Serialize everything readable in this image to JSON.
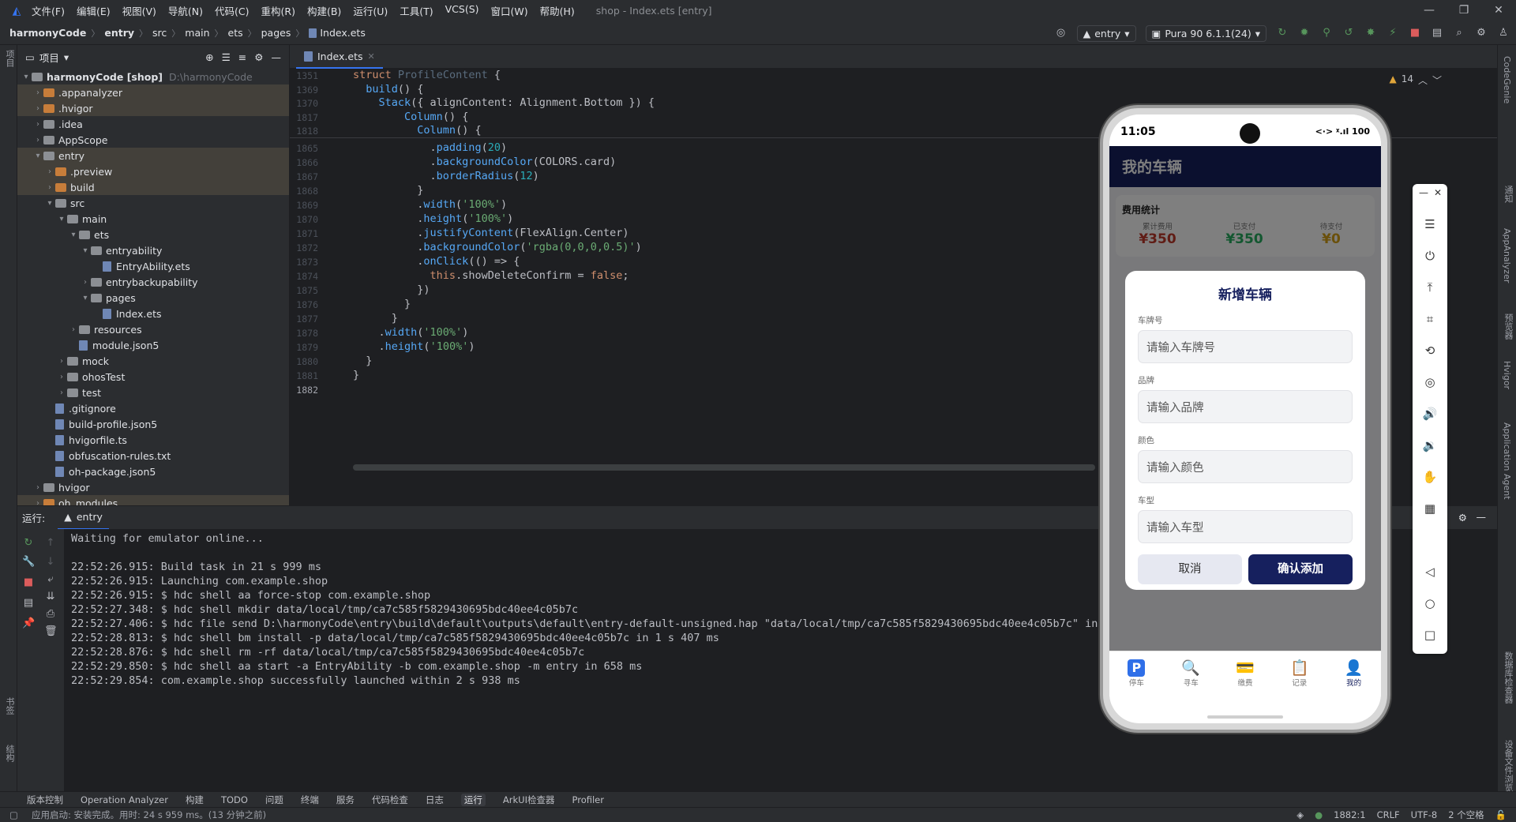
{
  "menu": {
    "items": [
      "文件(F)",
      "编辑(E)",
      "视图(V)",
      "导航(N)",
      "代码(C)",
      "重构(R)",
      "构建(B)",
      "运行(U)",
      "工具(T)",
      "VCS(S)",
      "窗口(W)",
      "帮助(H)"
    ],
    "window_title": "shop - Index.ets [entry]"
  },
  "breadcrumb": [
    "harmonyCode",
    "entry",
    "src",
    "main",
    "ets",
    "pages",
    "Index.ets"
  ],
  "toolbar": {
    "module": "entry",
    "device": "Pura 90 6.1.1(24)"
  },
  "project": {
    "header": "项目",
    "rows": [
      {
        "name": "harmonyCode [shop]",
        "hint": "D:\\harmonyCode",
        "level": 0,
        "type": "folder",
        "open": true,
        "hl": false
      },
      {
        "name": ".appanalyzer",
        "level": 1,
        "type": "folder-orange",
        "open": false,
        "hl": true
      },
      {
        "name": ".hvigor",
        "level": 1,
        "type": "folder-orange",
        "open": false,
        "hl": true
      },
      {
        "name": ".idea",
        "level": 1,
        "type": "folder",
        "open": false,
        "hl": false
      },
      {
        "name": "AppScope",
        "level": 1,
        "type": "folder",
        "open": false,
        "hl": false
      },
      {
        "name": "entry",
        "level": 1,
        "type": "folder",
        "open": true,
        "hl": true
      },
      {
        "name": ".preview",
        "level": 2,
        "type": "folder-orange",
        "open": false,
        "hl": true
      },
      {
        "name": "build",
        "level": 2,
        "type": "folder-orange",
        "open": false,
        "hl": true
      },
      {
        "name": "src",
        "level": 2,
        "type": "folder",
        "open": true,
        "hl": false
      },
      {
        "name": "main",
        "level": 3,
        "type": "folder",
        "open": true,
        "hl": false
      },
      {
        "name": "ets",
        "level": 4,
        "type": "folder",
        "open": true,
        "hl": false
      },
      {
        "name": "entryability",
        "level": 5,
        "type": "folder",
        "open": true,
        "hl": false
      },
      {
        "name": "EntryAbility.ets",
        "level": 6,
        "type": "file",
        "hl": false
      },
      {
        "name": "entrybackupability",
        "level": 5,
        "type": "folder",
        "open": false,
        "hl": false
      },
      {
        "name": "pages",
        "level": 5,
        "type": "folder",
        "open": true,
        "hl": false
      },
      {
        "name": "Index.ets",
        "level": 6,
        "type": "file",
        "hl": false
      },
      {
        "name": "resources",
        "level": 4,
        "type": "folder",
        "open": false,
        "hl": false
      },
      {
        "name": "module.json5",
        "level": 4,
        "type": "file",
        "hl": false
      },
      {
        "name": "mock",
        "level": 3,
        "type": "folder",
        "open": false,
        "hl": false
      },
      {
        "name": "ohosTest",
        "level": 3,
        "type": "folder",
        "open": false,
        "hl": false
      },
      {
        "name": "test",
        "level": 3,
        "type": "folder",
        "open": false,
        "hl": false
      },
      {
        "name": ".gitignore",
        "level": 2,
        "type": "file",
        "hl": false
      },
      {
        "name": "build-profile.json5",
        "level": 2,
        "type": "file",
        "hl": false
      },
      {
        "name": "hvigorfile.ts",
        "level": 2,
        "type": "file",
        "hl": false
      },
      {
        "name": "obfuscation-rules.txt",
        "level": 2,
        "type": "file",
        "hl": false
      },
      {
        "name": "oh-package.json5",
        "level": 2,
        "type": "file",
        "hl": false
      },
      {
        "name": "hvigor",
        "level": 1,
        "type": "folder",
        "open": false,
        "hl": false
      },
      {
        "name": "oh_modules",
        "level": 1,
        "type": "folder-orange",
        "open": false,
        "hl": true
      }
    ]
  },
  "editor": {
    "tab": "Index.ets",
    "warnings": "14",
    "sticky": [
      {
        "ln": "1351",
        "html": "<span class=\"kw\">struct</span> <span class=\"ty\">ProfileContent</span> {"
      },
      {
        "ln": "1369",
        "html": "  <span class=\"fn\">build</span>() {"
      },
      {
        "ln": "1370",
        "html": "    <span class=\"fn\">Stack</span>({ alignContent: Alignment.Bottom }) {"
      },
      {
        "ln": "1817",
        "html": "        <span class=\"fn\">Column</span>() {"
      },
      {
        "ln": "1818",
        "html": "          <span class=\"fn\">Column</span>() {"
      }
    ],
    "lines": [
      {
        "ln": "1865",
        "html": "            .<span class=\"fn\">padding</span>(<span class=\"num\">20</span>)"
      },
      {
        "ln": "1866",
        "html": "            .<span class=\"fn\">backgroundColor</span>(COLORS.card)"
      },
      {
        "ln": "1867",
        "html": "            .<span class=\"fn\">borderRadius</span>(<span class=\"num\">12</span>)"
      },
      {
        "ln": "1868",
        "html": "          }"
      },
      {
        "ln": "1869",
        "html": "          .<span class=\"fn\">width</span>(<span class=\"str\">'100%'</span>)"
      },
      {
        "ln": "1870",
        "html": "          .<span class=\"fn\">height</span>(<span class=\"str\">'100%'</span>)"
      },
      {
        "ln": "1871",
        "html": "          .<span class=\"fn\">justifyContent</span>(FlexAlign.Center)"
      },
      {
        "ln": "1872",
        "html": "          .<span class=\"fn\">backgroundColor</span>(<span class=\"str\">'rgba(0,0,0,0.5)'</span>)"
      },
      {
        "ln": "1873",
        "html": "          .<span class=\"fn\">onClick</span>(() => {"
      },
      {
        "ln": "1874",
        "html": "            <span class=\"kw\">this</span>.showDeleteConfirm = <span class=\"kw\">false</span>;"
      },
      {
        "ln": "1875",
        "html": "          })"
      },
      {
        "ln": "1876",
        "html": "        }"
      },
      {
        "ln": "1877",
        "html": "      }"
      },
      {
        "ln": "1878",
        "html": "    .<span class=\"fn\">width</span>(<span class=\"str\">'100%'</span>)"
      },
      {
        "ln": "1879",
        "html": "    .<span class=\"fn\">height</span>(<span class=\"str\">'100%'</span>)"
      },
      {
        "ln": "1880",
        "html": "  }"
      },
      {
        "ln": "1881",
        "html": "}"
      },
      {
        "ln": "1882",
        "html": ""
      }
    ]
  },
  "run": {
    "label": "运行:",
    "tab": "entry",
    "lines": [
      "Waiting for emulator online...",
      "",
      "22:52:26.915: Build task in 21 s 999 ms",
      "22:52:26.915: Launching com.example.shop",
      "22:52:26.915: $ hdc shell aa force-stop com.example.shop",
      "22:52:27.348: $ hdc shell mkdir data/local/tmp/ca7c585f5829430695bdc40ee4c05b7c",
      "22:52:27.406: $ hdc file send D:\\harmonyCode\\entry\\build\\default\\outputs\\default\\entry-default-unsigned.hap \"data/local/tmp/ca7c585f5829430695bdc40ee4c05b7c\" in 58",
      "22:52:28.813: $ hdc shell bm install -p data/local/tmp/ca7c585f5829430695bdc40ee4c05b7c in 1 s 407 ms",
      "22:52:28.876: $ hdc shell rm -rf data/local/tmp/ca7c585f5829430695bdc40ee4c05b7c",
      "22:52:29.850: $ hdc shell aa start -a EntryAbility -b com.example.shop -m entry in 658 ms",
      "22:52:29.854: com.example.shop successfully launched within 2 s 938 ms"
    ]
  },
  "bottom_tools": [
    "版本控制",
    "Operation Analyzer",
    "构建",
    "TODO",
    "问题",
    "终端",
    "服务",
    "代码检查",
    "日志",
    "运行",
    "ArkUI检查器",
    "Profiler"
  ],
  "active_tool": "运行",
  "status": {
    "message": "应用启动: 安装完成。用时: 24 s 959 ms。(13 分钟之前)",
    "position": "1882:1",
    "line_sep": "CRLF",
    "encoding": "UTF-8",
    "indent": "2 个空格"
  },
  "left_strip": {
    "top": "项目",
    "b1": "书签",
    "b2": "结构"
  },
  "right_strip": [
    "CodeGenie",
    "通知",
    "AppAnalyzer",
    "预览器",
    "Hvigor",
    "Application Agent",
    "数据库检查器",
    "设备文件浏览器"
  ],
  "phone": {
    "time": "11:05",
    "sys": "<·> ᵡ.ıl 100",
    "header": "我的车辆",
    "stats_title": "费用统计",
    "stats": [
      {
        "label": "累计费用",
        "value": "¥350",
        "color": "#c0392b"
      },
      {
        "label": "已支付",
        "value": "¥350",
        "color": "#27ae60"
      },
      {
        "label": "待支付",
        "value": "¥0",
        "color": "#d4a017"
      }
    ],
    "dialog": {
      "title": "新增车辆",
      "fields": [
        {
          "label": "车牌号",
          "placeholder": "请输入车牌号"
        },
        {
          "label": "品牌",
          "placeholder": "请输入品牌"
        },
        {
          "label": "颜色",
          "placeholder": "请输入颜色"
        },
        {
          "label": "车型",
          "placeholder": "请输入车型"
        }
      ],
      "cancel": "取消",
      "confirm": "确认添加"
    },
    "tabs": [
      {
        "icon": "P",
        "label": "停车",
        "name": "parking"
      },
      {
        "icon": "🔍",
        "label": "寻车",
        "name": "find-car"
      },
      {
        "icon": "💳",
        "label": "缴费",
        "name": "payment"
      },
      {
        "icon": "📋",
        "label": "记录",
        "name": "records"
      },
      {
        "icon": "👤",
        "label": "我的",
        "name": "mine"
      }
    ],
    "active_tab": 4
  }
}
